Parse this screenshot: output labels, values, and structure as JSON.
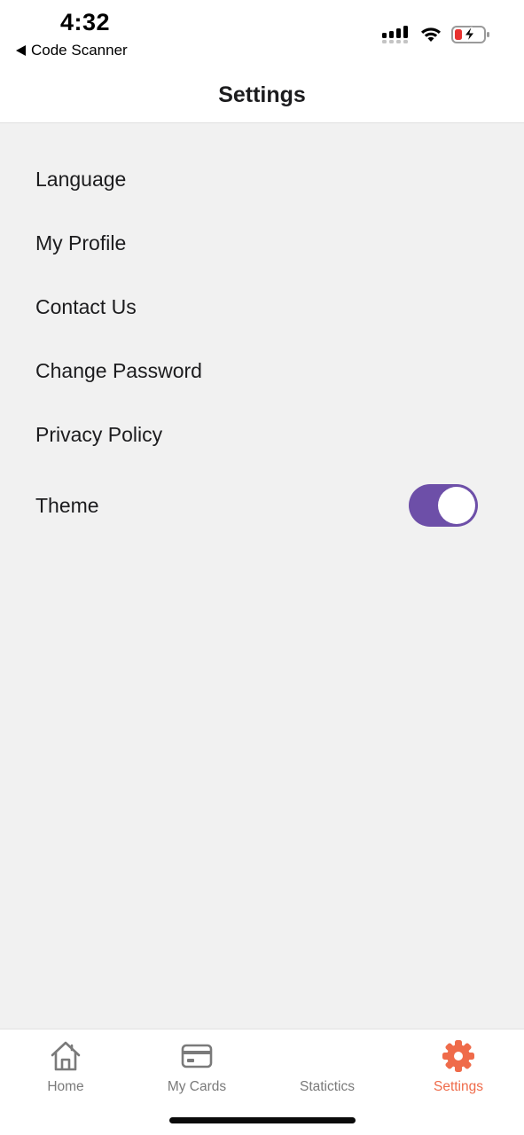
{
  "status_bar": {
    "time": "4:32",
    "back_app_label": "Code Scanner",
    "icons": [
      "cellular-signal-icon",
      "wifi-icon",
      "battery-charging-icon"
    ]
  },
  "header": {
    "title": "Settings"
  },
  "settings": {
    "items": [
      {
        "label": "Language"
      },
      {
        "label": "My Profile"
      },
      {
        "label": "Contact Us"
      },
      {
        "label": "Change Password"
      },
      {
        "label": "Privacy Policy"
      }
    ],
    "theme": {
      "label": "Theme",
      "toggle_on": true
    }
  },
  "tab_bar": {
    "tabs": [
      {
        "label": "Home",
        "icon": "home-icon",
        "active": false
      },
      {
        "label": "My Cards",
        "icon": "credit-card-icon",
        "active": false
      },
      {
        "label": "Statictics",
        "icon": "",
        "active": false
      },
      {
        "label": "Settings",
        "icon": "gear-icon",
        "active": true
      }
    ]
  },
  "colors": {
    "accent_toggle": "#6d4fa8",
    "active_tab": "#ef6b4a",
    "inactive_tab": "#7a7a7a",
    "background": "#f1f1f1"
  }
}
